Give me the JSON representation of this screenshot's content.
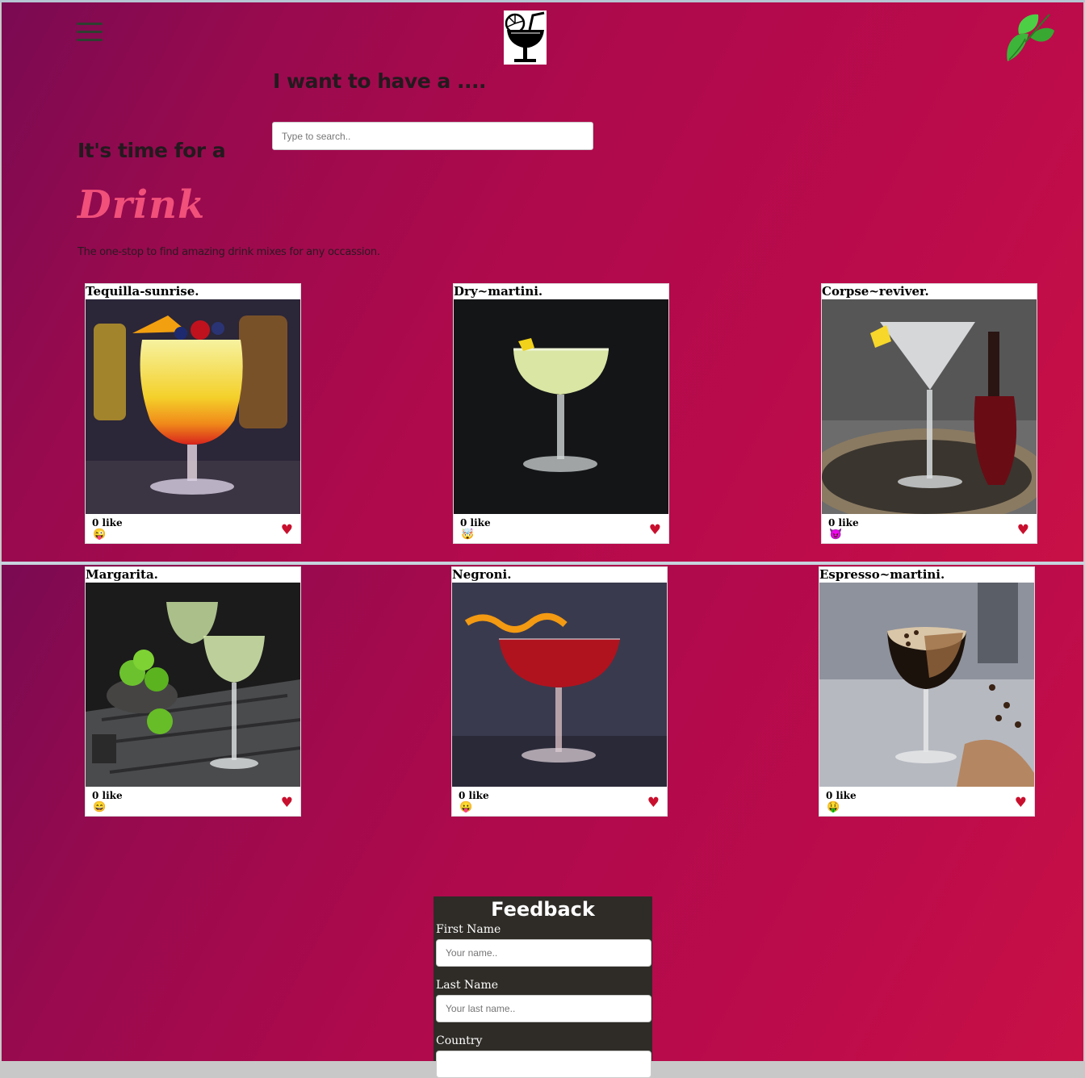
{
  "header": {
    "menu_icon": "hamburger-icon",
    "logo_icon": "cocktail-glass-icon",
    "mint_icon": "mint-leaf-icon"
  },
  "hero": {
    "search_heading": "I want to have a ....",
    "search_placeholder": "Type to search..",
    "heading_line1": "It's time for a",
    "heading_line2": "Drink",
    "tagline": "The one-stop to find amazing drink mixes for any occassion."
  },
  "drinks": [
    {
      "title": "Tequilla-sunrise.",
      "likes": "0 like",
      "emoji": "😜",
      "heart": "♥"
    },
    {
      "title": "Dry~martini.",
      "likes": "0 like",
      "emoji": "🤯",
      "heart": "♥"
    },
    {
      "title": "Corpse~reviver.",
      "likes": "0 like",
      "emoji": "😈",
      "heart": "♥"
    },
    {
      "title": "Margarita.",
      "likes": "0 like",
      "emoji": "😄",
      "heart": "♥"
    },
    {
      "title": "Negroni.",
      "likes": "0 like",
      "emoji": "😛",
      "heart": "♥"
    },
    {
      "title": "Espresso~martini.",
      "likes": "0 like",
      "emoji": "🤑",
      "heart": "♥"
    }
  ],
  "feedback": {
    "title": "Feedback",
    "first_name_label": "First Name",
    "first_name_placeholder": "Your name..",
    "last_name_label": "Last Name",
    "last_name_placeholder": "Your last name..",
    "country_label": "Country"
  },
  "colors": {
    "accent_pink": "#f0507a",
    "heart_red": "#c8102e",
    "form_bg": "#2f2c27"
  }
}
